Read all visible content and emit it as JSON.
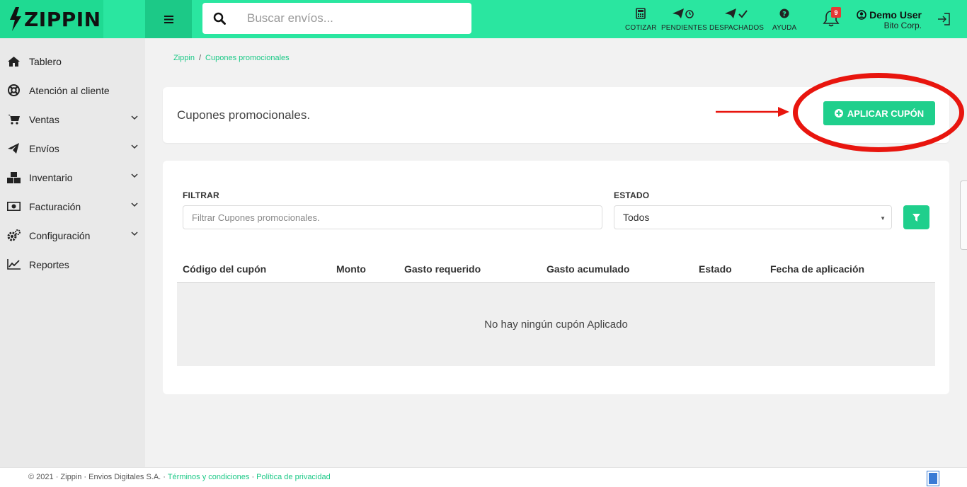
{
  "brand": {
    "name": "ZIPPIN"
  },
  "search": {
    "placeholder": "Buscar envíos..."
  },
  "nav": [
    {
      "label": "COTIZAR",
      "icon": "calculator-icon"
    },
    {
      "label": "PENDIENTES",
      "icon": "paper-plane-clock-icon"
    },
    {
      "label": "DESPACHADOS",
      "icon": "paper-plane-check-icon"
    },
    {
      "label": "AYUDA",
      "icon": "question-circle-icon"
    }
  ],
  "notifications": {
    "count": "9"
  },
  "user": {
    "name": "Demo User",
    "org": "Bito Corp."
  },
  "sidebar": {
    "items": [
      {
        "label": "Tablero",
        "icon": "home-icon"
      },
      {
        "label": "Atención al cliente",
        "icon": "lifebuoy-icon"
      },
      {
        "label": "Ventas",
        "icon": "cart-icon"
      },
      {
        "label": "Envíos",
        "icon": "paper-plane-icon"
      },
      {
        "label": "Inventario",
        "icon": "boxes-icon"
      },
      {
        "label": "Facturación",
        "icon": "money-bill-icon"
      },
      {
        "label": "Configuración",
        "icon": "cogs-icon"
      },
      {
        "label": "Reportes",
        "icon": "chart-line-icon"
      }
    ]
  },
  "breadcrumb": {
    "root": "Zippin",
    "sep": "/",
    "current": "Cupones promocionales"
  },
  "header_card": {
    "title": "Cupones promocionales.",
    "apply_button": "APLICAR CUPÓN"
  },
  "filters": {
    "filter_label": "FILTRAR",
    "filter_placeholder": "Filtrar Cupones promocionales.",
    "status_label": "ESTADO",
    "status_value": "Todos"
  },
  "table": {
    "columns": [
      "Código del cupón",
      "Monto",
      "Gasto requerido",
      "Gasto acumulado",
      "Estado",
      "Fecha de aplicación"
    ],
    "empty_text": "No hay ningún cupón Aplicado"
  },
  "footer": {
    "copyright": "© 2021 · Zippin · Envios Digitales S.A. · ",
    "terms": "Términos y condiciones",
    "dot": " · ",
    "privacy": "Política de privacidad"
  },
  "colors": {
    "brand_green": "#2ae6a0",
    "button_green": "#1fcf8c",
    "annotation_red": "#e8150e"
  }
}
